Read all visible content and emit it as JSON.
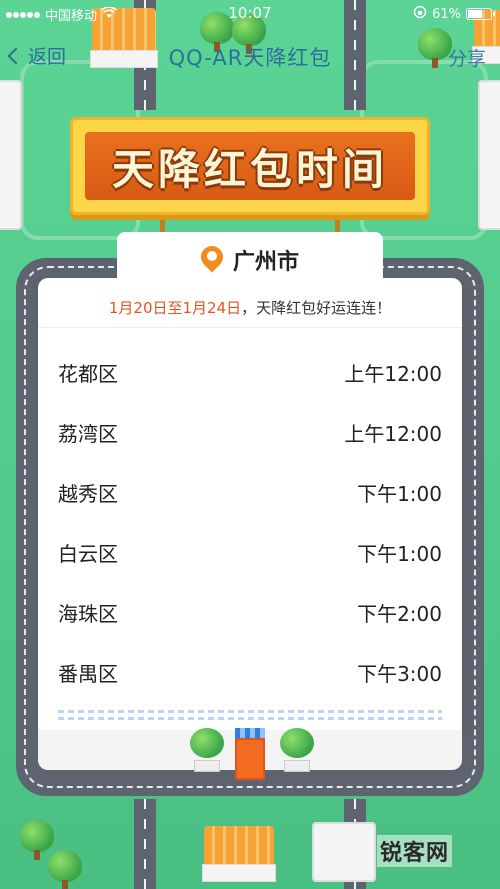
{
  "status_bar": {
    "carrier": "中国移动",
    "time": "10:07",
    "battery": "61%"
  },
  "nav": {
    "back_label": "返回",
    "title": "QQ-AR天降红包",
    "share_label": "分享"
  },
  "banner": {
    "title": "天降红包时间"
  },
  "city": {
    "name": "广州市"
  },
  "notice": {
    "date_range": "1月20日至1月24日",
    "message": "，天降红包好运连连！"
  },
  "schedule": [
    {
      "district": "花都区",
      "time": "上午12:00"
    },
    {
      "district": "荔湾区",
      "time": "上午12:00"
    },
    {
      "district": "越秀区",
      "time": "下午1:00"
    },
    {
      "district": "白云区",
      "time": "下午1:00"
    },
    {
      "district": "海珠区",
      "time": "下午2:00"
    },
    {
      "district": "番禺区",
      "time": "下午3:00"
    }
  ],
  "watermark": {
    "text": "锐客网"
  },
  "colors": {
    "grass": "#52c98b",
    "banner": "#e8711e",
    "accent_date": "#e8531e",
    "pin": "#f38b1f",
    "nav_text": "#2d6f9c"
  }
}
